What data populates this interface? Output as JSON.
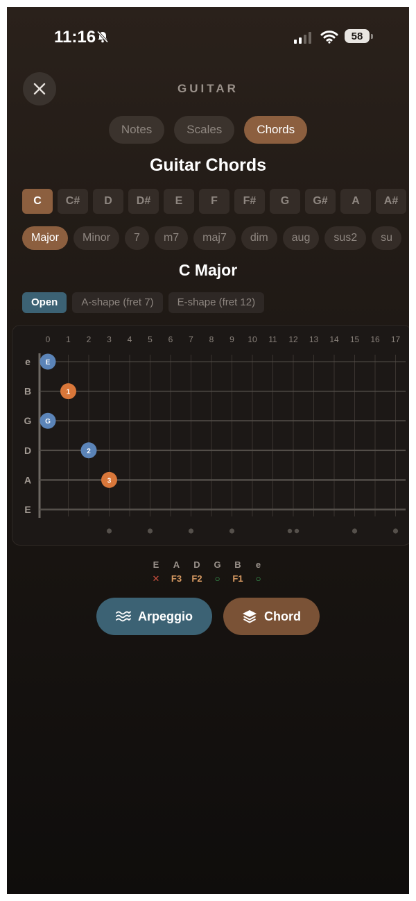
{
  "status_bar": {
    "time": "11:16",
    "battery": "58"
  },
  "header": {
    "title": "GUITAR",
    "close_icon": "close-icon"
  },
  "tabs": [
    {
      "label": "Notes",
      "active": false
    },
    {
      "label": "Scales",
      "active": false
    },
    {
      "label": "Chords",
      "active": true
    }
  ],
  "section_title": "Guitar Chords",
  "roots": [
    "C",
    "C#",
    "D",
    "D#",
    "E",
    "F",
    "F#",
    "G",
    "G#",
    "A",
    "A#"
  ],
  "selected_root": "C",
  "chord_types": [
    "Major",
    "Minor",
    "7",
    "m7",
    "maj7",
    "dim",
    "aug",
    "sus2",
    "su"
  ],
  "selected_type": "Major",
  "chord_title": "C Major",
  "voicings": [
    {
      "label": "Open",
      "active": true
    },
    {
      "label": "A-shape (fret 7)",
      "active": false
    },
    {
      "label": "E-shape (fret 12)",
      "active": false
    }
  ],
  "fretboard": {
    "fret_numbers": [
      "0",
      "1",
      "2",
      "3",
      "4",
      "5",
      "6",
      "7",
      "8",
      "9",
      "10",
      "11",
      "12",
      "13",
      "14",
      "15",
      "16",
      "17"
    ],
    "strings": [
      "e",
      "B",
      "G",
      "D",
      "A",
      "E"
    ],
    "markers": [
      {
        "string": "e",
        "fret": 0,
        "label": "E",
        "color": "#5b84b8"
      },
      {
        "string": "B",
        "fret": 1,
        "label": "1",
        "color": "#d9773a"
      },
      {
        "string": "G",
        "fret": 0,
        "label": "G",
        "color": "#5b84b8"
      },
      {
        "string": "D",
        "fret": 2,
        "label": "2",
        "color": "#5b84b8"
      },
      {
        "string": "A",
        "fret": 3,
        "label": "3",
        "color": "#d9773a"
      }
    ],
    "inlay_frets": [
      3,
      5,
      7,
      9,
      12,
      15,
      17
    ]
  },
  "tab_summary": [
    {
      "string": "E",
      "value": "✕",
      "kind": "muted"
    },
    {
      "string": "A",
      "value": "F3",
      "kind": "fret"
    },
    {
      "string": "D",
      "value": "F2",
      "kind": "fret"
    },
    {
      "string": "G",
      "value": "○",
      "kind": "open"
    },
    {
      "string": "B",
      "value": "F1",
      "kind": "fret"
    },
    {
      "string": "e",
      "value": "○",
      "kind": "open"
    }
  ],
  "colors": {
    "muted": "#c9503e",
    "fret": "#d79a62",
    "open": "#3fae5a",
    "accent": "#8c5f3f",
    "blue": "#3c6274"
  },
  "actions": {
    "arpeggio_label": "Arpeggio",
    "arpeggio_icon": "waves-icon",
    "chord_label": "Chord",
    "chord_icon": "layers-icon"
  }
}
